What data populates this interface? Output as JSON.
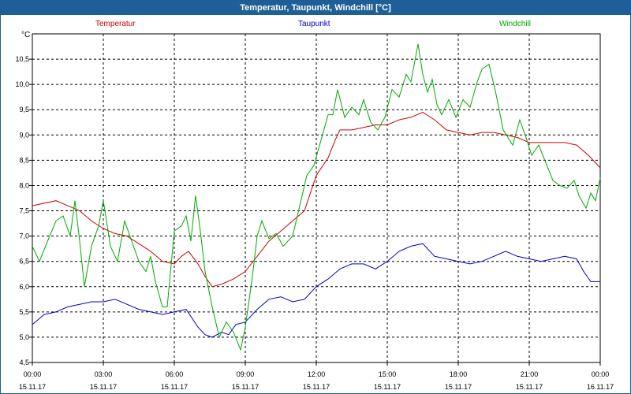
{
  "window": {
    "title": "Temperatur, Taupunkt, Windchill [°C]"
  },
  "chart_data": {
    "type": "line",
    "unit": "°C",
    "ylim": [
      4.5,
      11.0
    ],
    "y_ticks": [
      "4,5",
      "5,0",
      "5,5",
      "6,0",
      "6,5",
      "7,0",
      "7,5",
      "8,0",
      "8,5",
      "9,0",
      "9,5",
      "10,0",
      "10,5"
    ],
    "y_tick_values": [
      4.5,
      5.0,
      5.5,
      6.0,
      6.5,
      7.0,
      7.5,
      8.0,
      8.5,
      9.0,
      9.5,
      10.0,
      10.5
    ],
    "x_range_hours": [
      0,
      24
    ],
    "x_ticks": [
      {
        "time": "00:00",
        "date": "15.11.17",
        "hour": 0
      },
      {
        "time": "03:00",
        "date": "15.11.17",
        "hour": 3
      },
      {
        "time": "06:00",
        "date": "15.11.17",
        "hour": 6
      },
      {
        "time": "09:00",
        "date": "15.11.17",
        "hour": 9
      },
      {
        "time": "12:00",
        "date": "15.11.17",
        "hour": 12
      },
      {
        "time": "15:00",
        "date": "15.11.17",
        "hour": 15
      },
      {
        "time": "18:00",
        "date": "15.11.17",
        "hour": 18
      },
      {
        "time": "21:00",
        "date": "15.11.17",
        "hour": 21
      },
      {
        "time": "00:00",
        "date": "16.11.17",
        "hour": 24
      }
    ],
    "grid": true,
    "legend_position": "top",
    "series": [
      {
        "name": "Temperatur",
        "color": "#cc0000",
        "points": [
          [
            0,
            7.6
          ],
          [
            0.5,
            7.65
          ],
          [
            1,
            7.7
          ],
          [
            1.5,
            7.6
          ],
          [
            2,
            7.5
          ],
          [
            2.5,
            7.3
          ],
          [
            3,
            7.15
          ],
          [
            3.5,
            7.05
          ],
          [
            4,
            7.0
          ],
          [
            4.5,
            6.85
          ],
          [
            5,
            6.7
          ],
          [
            5.5,
            6.5
          ],
          [
            6,
            6.45
          ],
          [
            6.3,
            6.6
          ],
          [
            6.6,
            6.7
          ],
          [
            7,
            6.45
          ],
          [
            7.3,
            6.2
          ],
          [
            7.6,
            6.0
          ],
          [
            8,
            6.05
          ],
          [
            8.5,
            6.15
          ],
          [
            9,
            6.3
          ],
          [
            9.5,
            6.6
          ],
          [
            10,
            6.9
          ],
          [
            10.5,
            7.1
          ],
          [
            11,
            7.3
          ],
          [
            11.5,
            7.5
          ],
          [
            12,
            8.2
          ],
          [
            12.5,
            8.55
          ],
          [
            12.8,
            8.9
          ],
          [
            13,
            9.1
          ],
          [
            13.5,
            9.1
          ],
          [
            14,
            9.15
          ],
          [
            14.5,
            9.2
          ],
          [
            15,
            9.2
          ],
          [
            15.5,
            9.3
          ],
          [
            16,
            9.35
          ],
          [
            16.5,
            9.45
          ],
          [
            17,
            9.3
          ],
          [
            17.5,
            9.1
          ],
          [
            18,
            9.05
          ],
          [
            18.5,
            9.0
          ],
          [
            19,
            9.05
          ],
          [
            19.5,
            9.05
          ],
          [
            20,
            9.0
          ],
          [
            20.5,
            8.95
          ],
          [
            21,
            8.85
          ],
          [
            21.5,
            8.85
          ],
          [
            22,
            8.85
          ],
          [
            22.5,
            8.85
          ],
          [
            23,
            8.8
          ],
          [
            23.5,
            8.6
          ],
          [
            24,
            8.35
          ]
        ]
      },
      {
        "name": "Taupunkt",
        "color": "#0000cc",
        "points": [
          [
            0,
            5.25
          ],
          [
            0.5,
            5.45
          ],
          [
            1,
            5.5
          ],
          [
            1.5,
            5.6
          ],
          [
            2,
            5.65
          ],
          [
            2.5,
            5.7
          ],
          [
            3,
            5.7
          ],
          [
            3.5,
            5.75
          ],
          [
            4,
            5.65
          ],
          [
            4.5,
            5.55
          ],
          [
            5,
            5.5
          ],
          [
            5.5,
            5.45
          ],
          [
            6,
            5.5
          ],
          [
            6.5,
            5.55
          ],
          [
            7,
            5.2
          ],
          [
            7.3,
            5.05
          ],
          [
            7.6,
            5.0
          ],
          [
            8,
            5.1
          ],
          [
            8.3,
            5.05
          ],
          [
            8.6,
            5.25
          ],
          [
            9,
            5.3
          ],
          [
            9.5,
            5.55
          ],
          [
            10,
            5.75
          ],
          [
            10.5,
            5.8
          ],
          [
            11,
            5.7
          ],
          [
            11.5,
            5.75
          ],
          [
            12,
            6.0
          ],
          [
            12.5,
            6.15
          ],
          [
            13,
            6.35
          ],
          [
            13.5,
            6.45
          ],
          [
            14,
            6.45
          ],
          [
            14.5,
            6.35
          ],
          [
            15,
            6.5
          ],
          [
            15.5,
            6.7
          ],
          [
            16,
            6.8
          ],
          [
            16.5,
            6.85
          ],
          [
            17,
            6.6
          ],
          [
            17.5,
            6.55
          ],
          [
            18,
            6.5
          ],
          [
            18.5,
            6.45
          ],
          [
            19,
            6.5
          ],
          [
            19.5,
            6.6
          ],
          [
            20,
            6.7
          ],
          [
            20.5,
            6.6
          ],
          [
            21,
            6.55
          ],
          [
            21.5,
            6.5
          ],
          [
            22,
            6.55
          ],
          [
            22.5,
            6.6
          ],
          [
            23,
            6.55
          ],
          [
            23.3,
            6.3
          ],
          [
            23.6,
            6.1
          ],
          [
            24,
            6.1
          ]
        ]
      },
      {
        "name": "Windchill",
        "color": "#00aa00",
        "points": [
          [
            0,
            6.8
          ],
          [
            0.3,
            6.5
          ],
          [
            0.6,
            6.85
          ],
          [
            1,
            7.3
          ],
          [
            1.3,
            7.4
          ],
          [
            1.6,
            7.0
          ],
          [
            1.8,
            7.7
          ],
          [
            2,
            6.9
          ],
          [
            2.2,
            6.0
          ],
          [
            2.5,
            6.8
          ],
          [
            2.8,
            7.2
          ],
          [
            3.0,
            7.7
          ],
          [
            3.3,
            6.8
          ],
          [
            3.6,
            6.5
          ],
          [
            3.9,
            7.3
          ],
          [
            4.2,
            6.9
          ],
          [
            4.5,
            6.5
          ],
          [
            4.8,
            6.3
          ],
          [
            5,
            6.6
          ],
          [
            5.2,
            6.1
          ],
          [
            5.5,
            5.6
          ],
          [
            5.7,
            5.6
          ],
          [
            6,
            7.1
          ],
          [
            6.3,
            7.2
          ],
          [
            6.5,
            7.4
          ],
          [
            6.7,
            6.9
          ],
          [
            6.9,
            7.8
          ],
          [
            7.1,
            7.1
          ],
          [
            7.3,
            6.3
          ],
          [
            7.6,
            5.6
          ],
          [
            7.9,
            5.0
          ],
          [
            8.2,
            5.3
          ],
          [
            8.5,
            5.1
          ],
          [
            8.8,
            4.75
          ],
          [
            9,
            5.2
          ],
          [
            9.3,
            6.2
          ],
          [
            9.5,
            7.0
          ],
          [
            9.7,
            7.3
          ],
          [
            10,
            6.95
          ],
          [
            10.3,
            7.05
          ],
          [
            10.6,
            6.8
          ],
          [
            11,
            7.0
          ],
          [
            11.3,
            7.6
          ],
          [
            11.6,
            8.2
          ],
          [
            11.9,
            8.4
          ],
          [
            12.2,
            8.9
          ],
          [
            12.5,
            9.4
          ],
          [
            12.7,
            9.4
          ],
          [
            12.9,
            9.9
          ],
          [
            13.2,
            9.35
          ],
          [
            13.5,
            9.55
          ],
          [
            13.8,
            9.4
          ],
          [
            14,
            9.7
          ],
          [
            14.3,
            9.25
          ],
          [
            14.6,
            9.1
          ],
          [
            14.9,
            9.35
          ],
          [
            15.2,
            9.9
          ],
          [
            15.5,
            9.75
          ],
          [
            15.8,
            10.2
          ],
          [
            16,
            10.05
          ],
          [
            16.3,
            10.8
          ],
          [
            16.5,
            10.2
          ],
          [
            16.7,
            9.85
          ],
          [
            16.9,
            10.1
          ],
          [
            17.1,
            9.6
          ],
          [
            17.3,
            9.4
          ],
          [
            17.6,
            9.7
          ],
          [
            17.9,
            9.35
          ],
          [
            18.2,
            9.7
          ],
          [
            18.5,
            9.55
          ],
          [
            18.8,
            10.05
          ],
          [
            19,
            10.3
          ],
          [
            19.3,
            10.4
          ],
          [
            19.6,
            9.8
          ],
          [
            19.9,
            9.1
          ],
          [
            20.1,
            8.95
          ],
          [
            20.3,
            8.8
          ],
          [
            20.6,
            9.3
          ],
          [
            20.9,
            8.9
          ],
          [
            21.1,
            8.6
          ],
          [
            21.4,
            8.8
          ],
          [
            21.7,
            8.45
          ],
          [
            22,
            8.1
          ],
          [
            22.3,
            8.0
          ],
          [
            22.6,
            7.95
          ],
          [
            22.9,
            8.1
          ],
          [
            23.1,
            7.8
          ],
          [
            23.4,
            7.55
          ],
          [
            23.6,
            7.85
          ],
          [
            23.8,
            7.7
          ],
          [
            24,
            8.15
          ]
        ]
      }
    ]
  }
}
